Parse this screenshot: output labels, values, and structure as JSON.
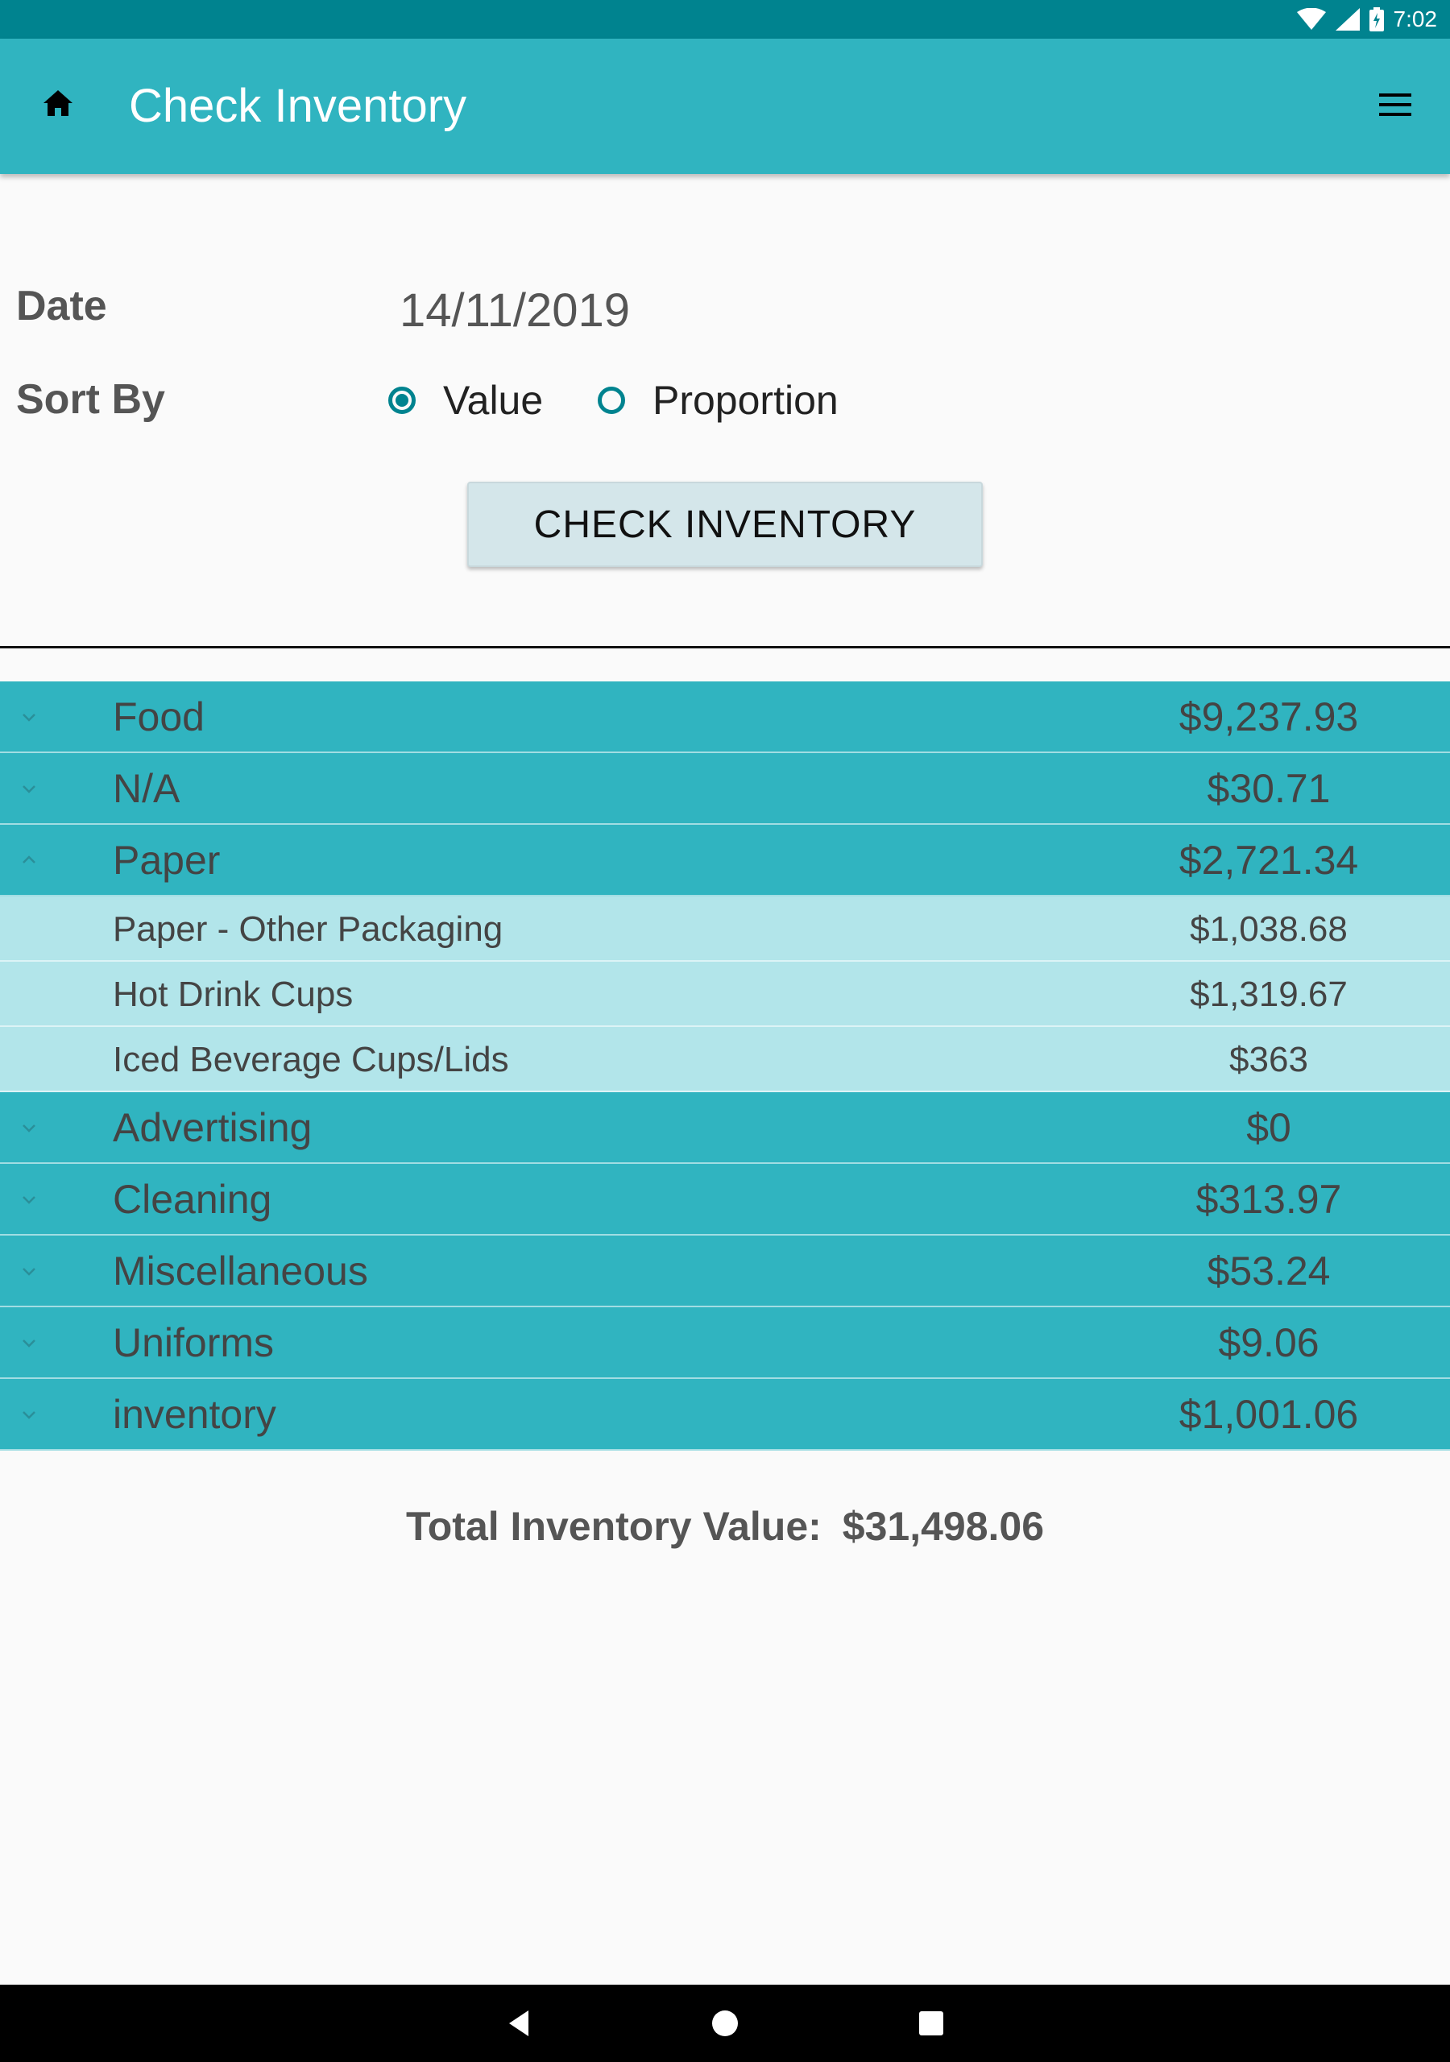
{
  "status_bar": {
    "time": "7:02"
  },
  "app_bar": {
    "title": "Check Inventory"
  },
  "form": {
    "date_label": "Date",
    "date_value": "14/11/2019",
    "sort_label": "Sort By",
    "sort_options": [
      "Value",
      "Proportion"
    ],
    "selected_sort": "Value",
    "check_button": "CHECK INVENTORY"
  },
  "categories": [
    {
      "name": "Food",
      "value": "$9,237.93",
      "expanded": false
    },
    {
      "name": "N/A",
      "value": "$30.71",
      "expanded": false
    },
    {
      "name": "Paper",
      "value": "$2,721.34",
      "expanded": true,
      "children": [
        {
          "name": "Paper - Other Packaging",
          "value": "$1,038.68"
        },
        {
          "name": "Hot Drink Cups",
          "value": "$1,319.67"
        },
        {
          "name": "Iced Beverage Cups/Lids",
          "value": "$363"
        }
      ]
    },
    {
      "name": "Advertising",
      "value": "$0",
      "expanded": false
    },
    {
      "name": "Cleaning",
      "value": "$313.97",
      "expanded": false
    },
    {
      "name": "Miscellaneous",
      "value": "$53.24",
      "expanded": false
    },
    {
      "name": "Uniforms",
      "value": "$9.06",
      "expanded": false
    },
    {
      "name": "inventory",
      "value": "$1,001.06",
      "expanded": false
    }
  ],
  "total": {
    "label": "Total Inventory Value:",
    "value": "$31,498.06"
  },
  "icons": {
    "home": "home-icon",
    "menu": "hamburger-menu-icon",
    "expand": "chevron-down-icon",
    "collapse": "chevron-up-icon",
    "nav_back": "back-triangle-icon",
    "nav_home": "home-circle-icon",
    "nav_recents": "recents-square-icon"
  },
  "colors": {
    "status_bar": "#00838f",
    "app_bar": "#30b4c0",
    "group_row": "#30b4c0",
    "child_row": "#b2e5ea",
    "accent": "#00838f"
  }
}
